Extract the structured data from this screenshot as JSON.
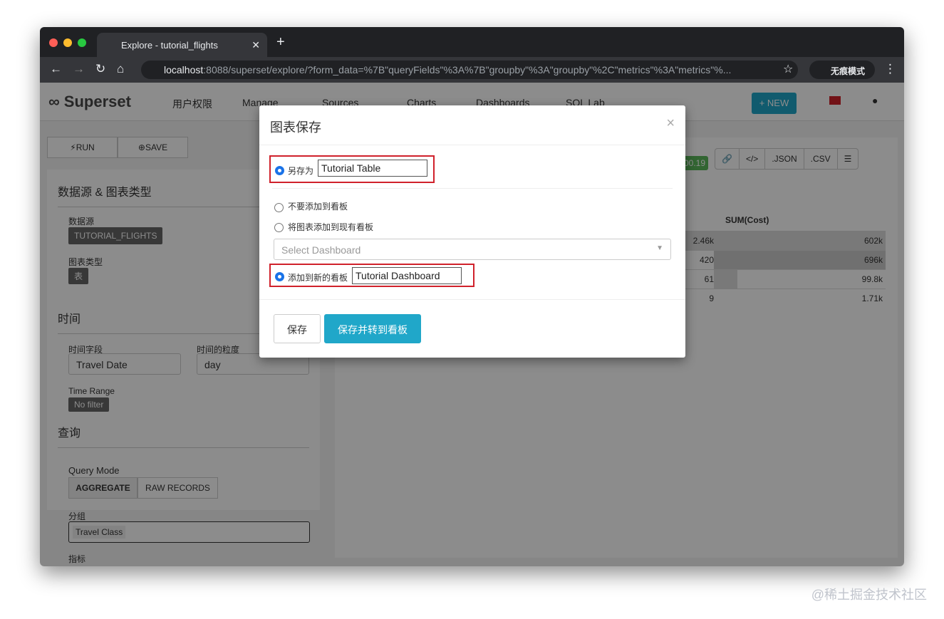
{
  "browser": {
    "tab_title": "Explore - tutorial_flights",
    "url_host": "localhost",
    "url_rest": ":8088/superset/explore/?form_data=%7B\"queryFields\"%3A%7B\"groupby\"%3A\"groupby\"%2C\"metrics\"%3A\"metrics\"%...",
    "incognito": "无痕模式"
  },
  "nav": {
    "logo": "Superset",
    "items": [
      "用户权限",
      "Manage",
      "Sources",
      "Charts",
      "Dashboards",
      "SQL Lab"
    ],
    "new": "+ NEW"
  },
  "left": {
    "run": "RUN",
    "save": "SAVE",
    "section1": "数据源 & 图表类型",
    "datasource_label": "数据源",
    "datasource": "TUTORIAL_FLIGHTS",
    "charttype_label": "图表类型",
    "charttype": "表",
    "time": "时间",
    "time_field_label": "时间字段",
    "time_field": "Travel Date",
    "grain_label": "时间的粒度",
    "grain": "day",
    "range_label": "Time Range",
    "range": "No filter",
    "query": "查询",
    "query_mode": "Query Mode",
    "aggregate": "AGGREGATE",
    "raw": "RAW RECORDS",
    "group_label": "分组",
    "group_tag": "Travel Class",
    "metrics_label": "指标"
  },
  "right": {
    "row_count": "00.19",
    "json": ".JSON",
    "csv": ".CSV",
    "col_header": "SUM(Cost)",
    "rows": [
      [
        "2.46k",
        "602k"
      ],
      [
        "420",
        "696k"
      ],
      [
        "61",
        "99.8k"
      ],
      [
        "9",
        "1.71k"
      ]
    ]
  },
  "modal": {
    "title": "图表保存",
    "save_as_label": "另存为",
    "save_as_value": "Tutorial Table",
    "no_dashboard": "不要添加到看板",
    "add_existing": "将图表添加到现有看板",
    "select_placeholder": "Select Dashboard",
    "add_new": "添加到新的看板",
    "new_dashboard_value": "Tutorial Dashboard",
    "save": "保存",
    "save_go": "保存并转到看板"
  },
  "watermark": "@稀土掘金技术社区"
}
